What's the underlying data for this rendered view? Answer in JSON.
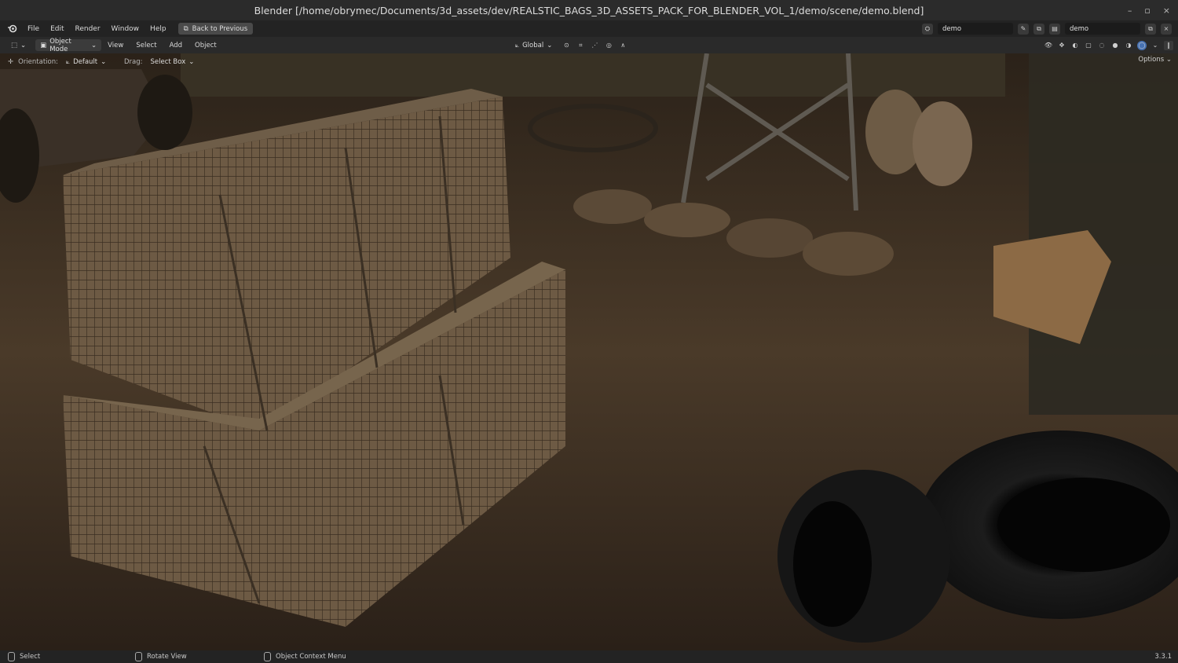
{
  "window": {
    "title": "Blender [/home/obrymec/Documents/3d_assets/dev/REALSTIC_BAGS_3D_ASSETS_PACK_FOR_BLENDER_VOL_1/demo/scene/demo.blend]",
    "minimize": "–",
    "maximize": "▫",
    "close": "×"
  },
  "menubar": {
    "items": [
      "File",
      "Edit",
      "Render",
      "Window",
      "Help"
    ],
    "back_button": "Back to Previous",
    "scene_name": "demo",
    "view_layer_name": "demo"
  },
  "header": {
    "mode": "Object Mode",
    "menus": [
      "View",
      "Select",
      "Add",
      "Object"
    ],
    "transform_orientation": "Global"
  },
  "tool_options": {
    "orientation_label": "Orientation:",
    "orientation_value": "Default",
    "drag_label": "Drag:",
    "drag_value": "Select Box",
    "options_button": "Options"
  },
  "statusbar": {
    "select": "Select",
    "rotate_view": "Rotate View",
    "context_menu": "Object Context Menu",
    "version": "3.3.1"
  }
}
